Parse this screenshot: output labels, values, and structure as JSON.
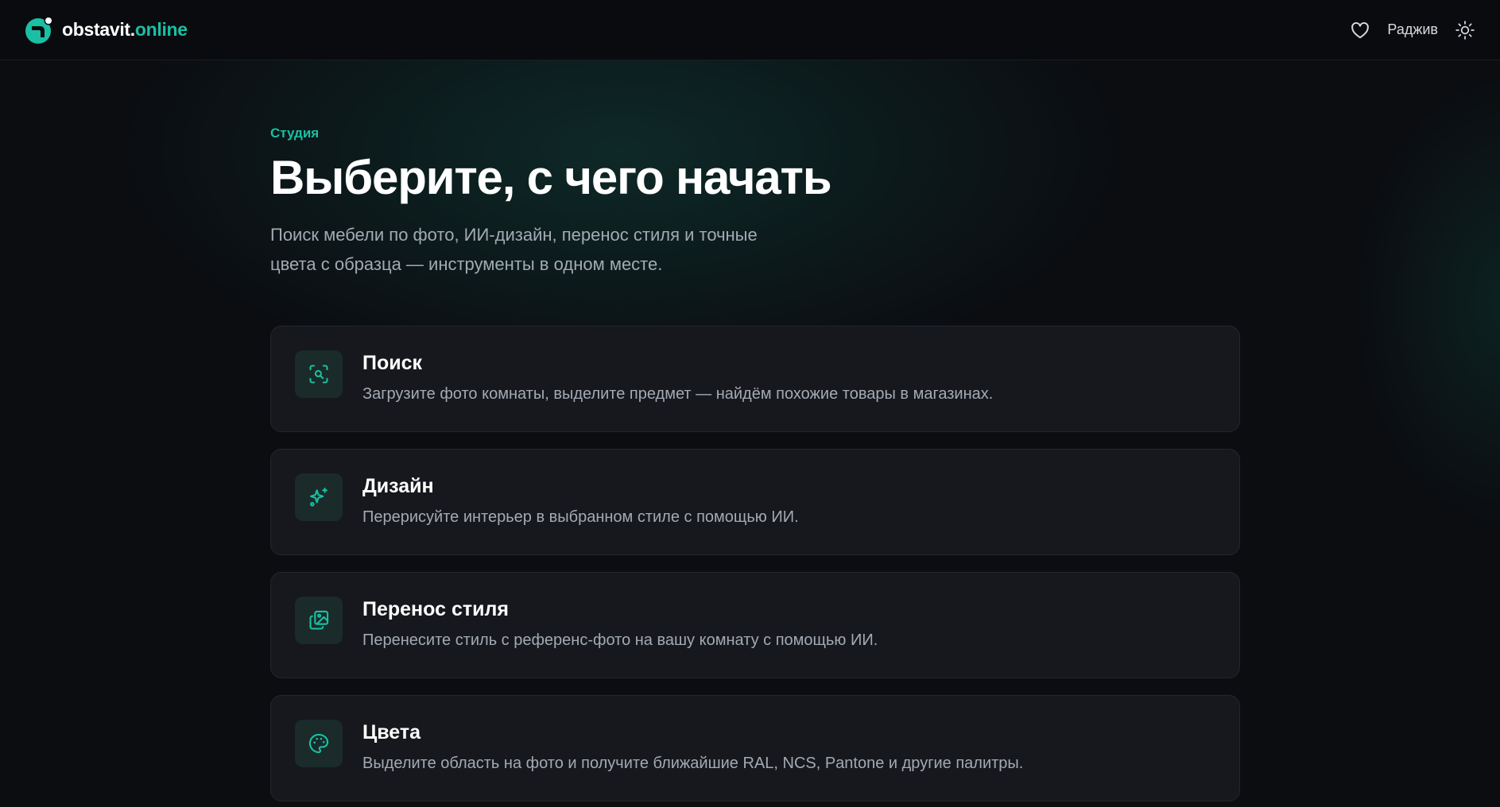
{
  "header": {
    "brand_main": "obstavit.",
    "brand_tld": "online",
    "user_name": "Раджив",
    "icons": {
      "favorites": "heart-icon",
      "theme": "sun-icon",
      "logo": "logo-mark"
    }
  },
  "hero": {
    "eyebrow": "Студия",
    "title": "Выберите, с чего начать",
    "subtitle_line1": "Поиск мебели по фото, ИИ-дизайн, перенос стиля и точные",
    "subtitle_line2": "цвета с образца — инструменты в одном месте."
  },
  "cards": [
    {
      "title": "Поиск",
      "description": "Загрузите фото комнаты, выделите предмет — найдём похожие товары в магазинах.",
      "icon": "scan-search-icon"
    },
    {
      "title": "Дизайн",
      "description": "Перерисуйте интерьер в выбранном стиле с помощью ИИ.",
      "icon": "sparkles-icon"
    },
    {
      "title": "Перенос стиля",
      "description": "Перенесите стиль с референс-фото на вашу комнату с помощью ИИ.",
      "icon": "images-icon"
    },
    {
      "title": "Цвета",
      "description": "Выделите область на фото и получите ближайшие RAL, NCS, Pantone и другие палитры.",
      "icon": "palette-icon"
    }
  ],
  "colors": {
    "accent": "#19c0a3",
    "background": "#0b0d11",
    "card_background": "#16181d",
    "muted_text": "#a3aab4"
  }
}
